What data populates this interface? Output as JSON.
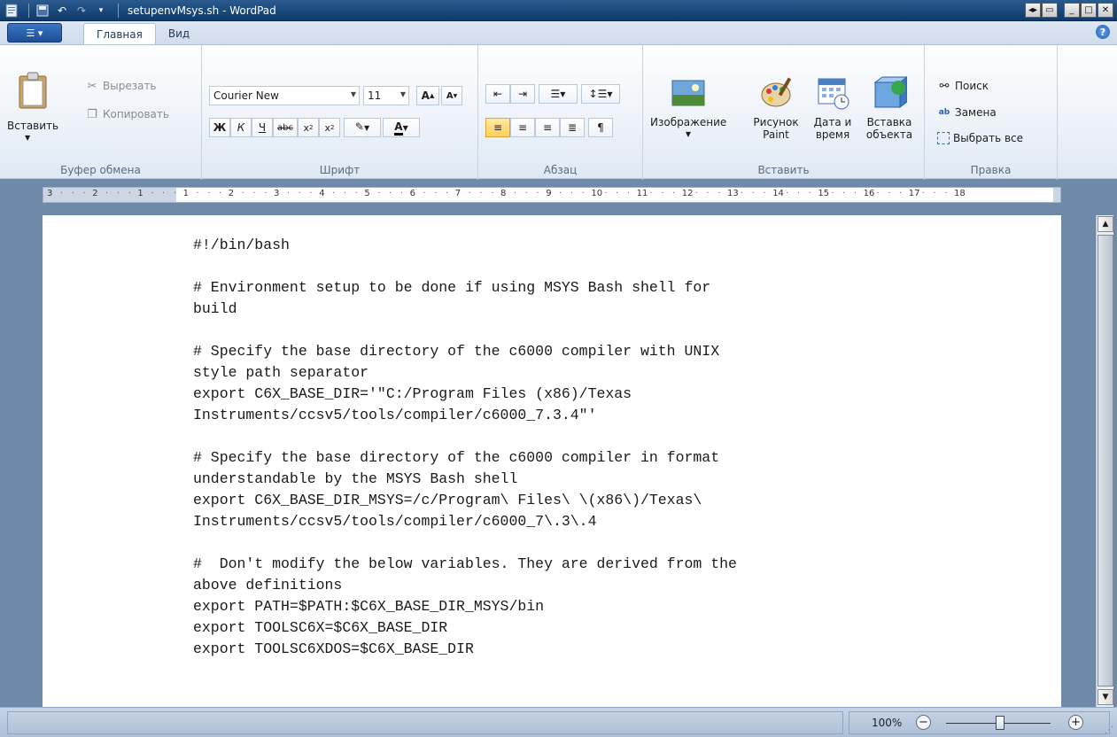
{
  "window": {
    "title": "setupenvMsys.sh - WordPad"
  },
  "tabs": {
    "home": "Главная",
    "view": "Вид"
  },
  "clipboard": {
    "paste": "Вставить",
    "cut": "Вырезать",
    "copy": "Копировать",
    "group_label": "Буфер обмена"
  },
  "font": {
    "family": "Courier New",
    "size": "11",
    "group_label": "Шрифт"
  },
  "paragraph": {
    "group_label": "Абзац"
  },
  "insert": {
    "picture": "Изображение",
    "paint_line1": "Рисунок",
    "paint_line2": "Paint",
    "datetime_line1": "Дата и",
    "datetime_line2": "время",
    "object_line1": "Вставка",
    "object_line2": "объекта",
    "group_label": "Вставить"
  },
  "editing": {
    "find": "Поиск",
    "replace": "Замена",
    "select_all": "Выбрать все",
    "group_label": "Правка"
  },
  "ruler": {
    "labels": [
      "3",
      "2",
      "1",
      "1",
      "2",
      "3",
      "4",
      "5",
      "6",
      "7",
      "8",
      "9",
      "10",
      "11",
      "12",
      "13",
      "14",
      "15",
      "16",
      "17",
      "18"
    ]
  },
  "document": {
    "text": "#!/bin/bash\n\n# Environment setup to be done if using MSYS Bash shell for\nbuild\n\n# Specify the base directory of the c6000 compiler with UNIX\nstyle path separator\nexport C6X_BASE_DIR='\"C:/Program Files (x86)/Texas\nInstruments/ccsv5/tools/compiler/c6000_7.3.4\"'\n\n# Specify the base directory of the c6000 compiler in format\nunderstandable by the MSYS Bash shell\nexport C6X_BASE_DIR_MSYS=/c/Program\\ Files\\ \\(x86\\)/Texas\\\nInstruments/ccsv5/tools/compiler/c6000_7\\.3\\.4\n\n#  Don't modify the below variables. They are derived from the\nabove definitions\nexport PATH=$PATH:$C6X_BASE_DIR_MSYS/bin\nexport TOOLSC6X=$C6X_BASE_DIR\nexport TOOLSC6XDOS=$C6X_BASE_DIR"
  },
  "status": {
    "zoom": "100%",
    "zoom_level": 1.0
  }
}
